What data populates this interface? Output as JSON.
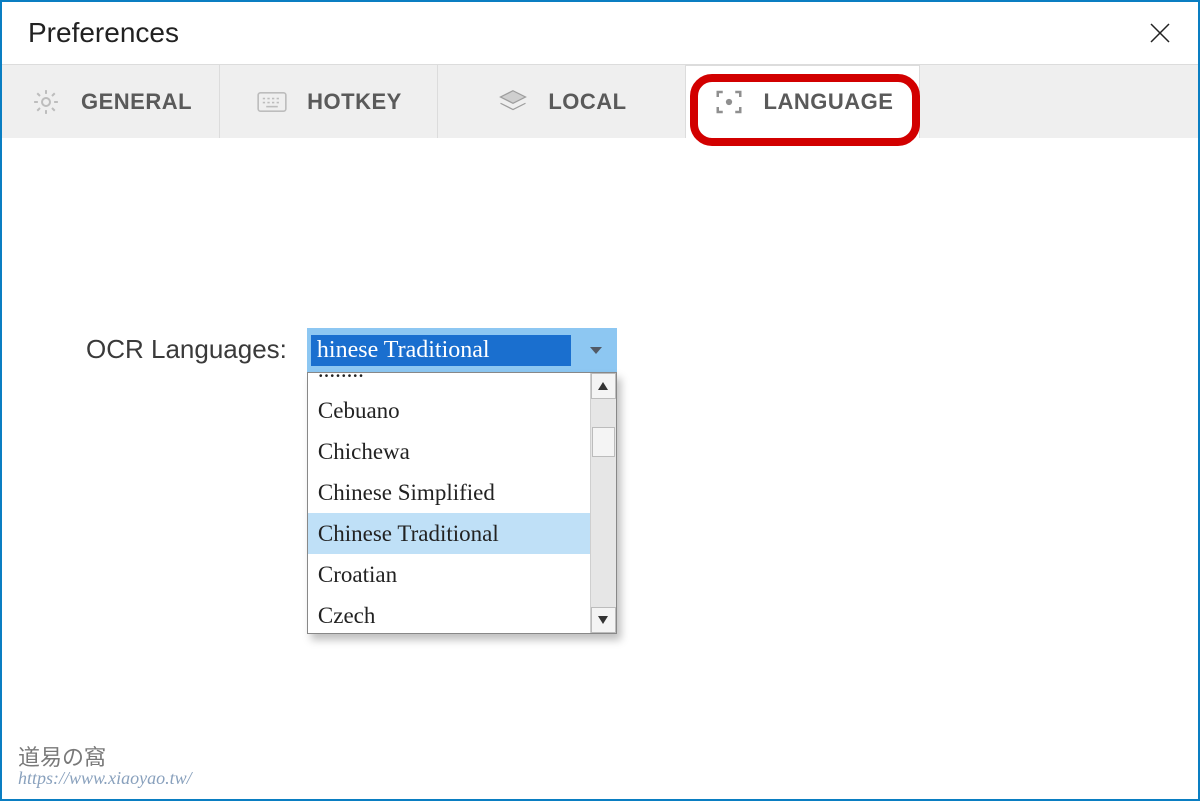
{
  "window": {
    "title": "Preferences"
  },
  "tabs": {
    "general": "GENERAL",
    "hotkey": "HOTKEY",
    "local": "LOCAL",
    "language": "LANGUAGE"
  },
  "form": {
    "ocr_label": "OCR Languages:",
    "ocr_selected_display": "hinese Traditional",
    "ocr_options": [
      "Cebuano",
      "Chichewa",
      "Chinese Simplified",
      "Chinese Traditional",
      "Croatian",
      "Czech"
    ],
    "ocr_highlight_index": 3
  },
  "watermark": {
    "stamp": "道易の窩",
    "url": "https://www.xiaoyao.tw/"
  }
}
